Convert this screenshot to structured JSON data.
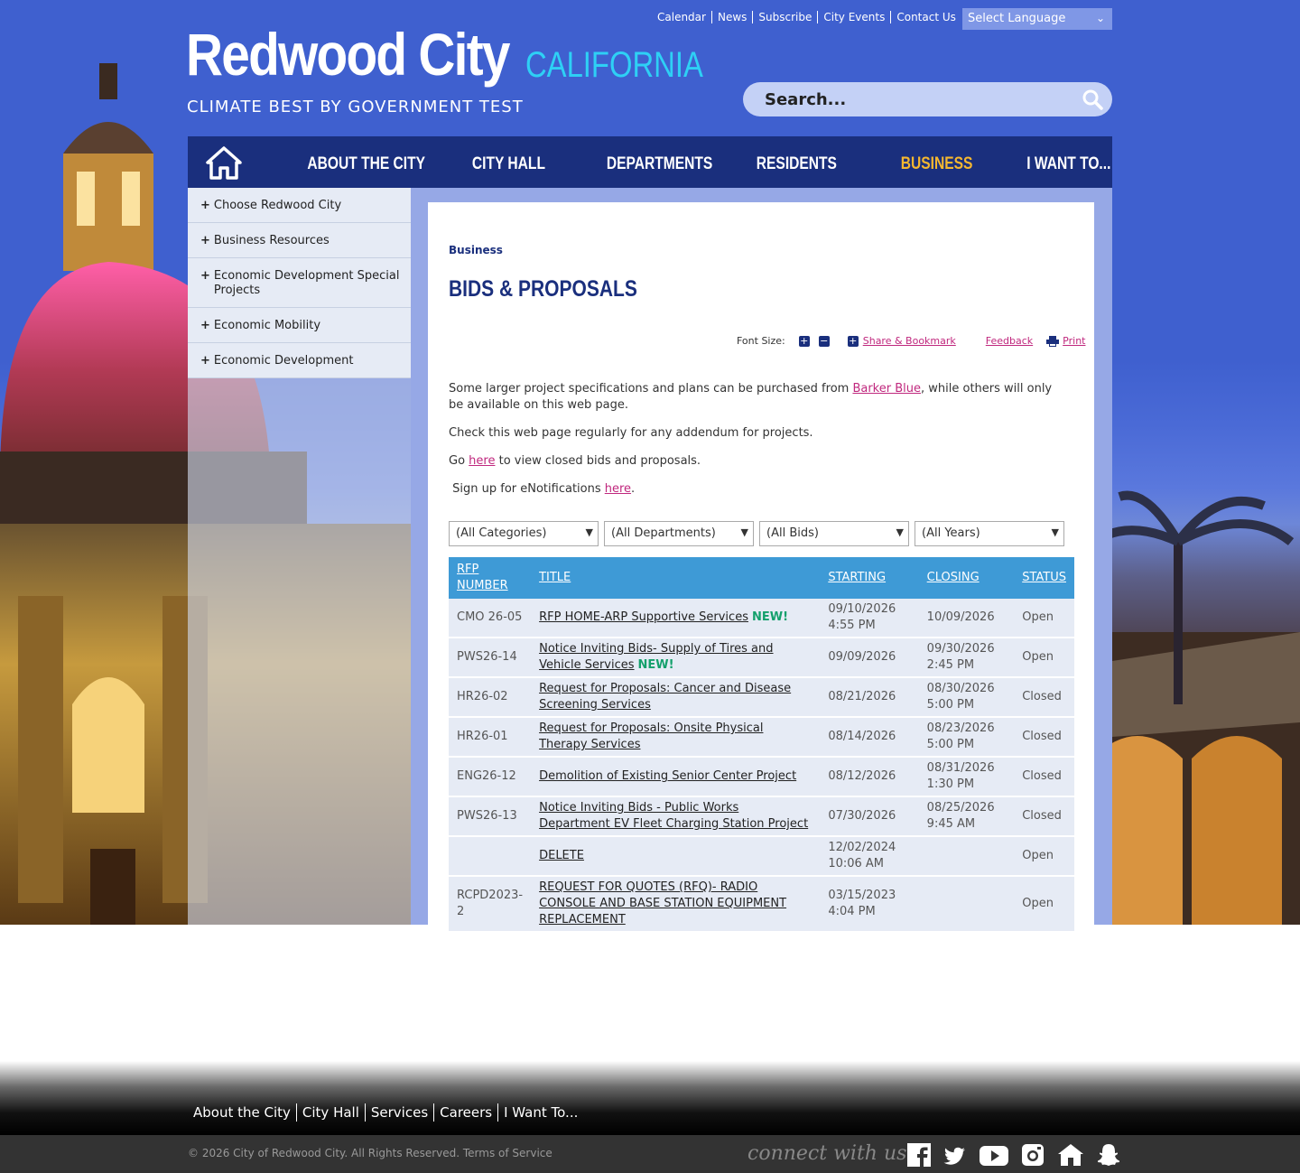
{
  "utility": {
    "links": [
      "Calendar",
      "News",
      "Subscribe",
      "City Events",
      "Contact Us"
    ],
    "language": "Select Language"
  },
  "brand": {
    "title": "Redwood City",
    "state": "CALIFORNIA",
    "tagline": "CLIMATE BEST BY GOVERNMENT TEST"
  },
  "search": {
    "placeholder": "Search..."
  },
  "nav": {
    "items": [
      "ABOUT THE CITY",
      "CITY HALL",
      "DEPARTMENTS",
      "RESIDENTS",
      "BUSINESS",
      "I WANT TO..."
    ],
    "active": "BUSINESS"
  },
  "sidebar": {
    "items": [
      "Choose Redwood City",
      "Business Resources",
      "Economic Development Special Projects",
      "Economic Mobility",
      "Economic Development"
    ]
  },
  "page": {
    "breadcrumb": "Business",
    "title": "BIDS & PROPOSALS",
    "tools": {
      "font_size": "Font Size:",
      "share": "Share & Bookmark",
      "feedback": "Feedback",
      "print": "Print"
    },
    "intro": {
      "p1_before": "Some larger project specifications and plans can be purchased from ",
      "p1_link": "Barker Blue",
      "p1_after": ", while others will only be available on this web page.",
      "p2": "Check this web page regularly for any addendum for projects.",
      "p3_before": "Go ",
      "p3_link": "here",
      "p3_after": " to view closed bids and proposals.",
      "p4_before": " Sign up for eNotifications ",
      "p4_link": "here",
      "p4_after": "."
    },
    "filters": [
      "(All Categories)",
      "(All Departments)",
      "(All Bids)",
      "(All Years)"
    ]
  },
  "table": {
    "headers": {
      "rfp": "RFP NUMBER",
      "title": "TITLE",
      "starting": "STARTING",
      "closing": "CLOSING",
      "status": "STATUS"
    },
    "new_label": "NEW!",
    "rows": [
      {
        "rfp": "CMO 26-05",
        "title": "RFP HOME-ARP Supportive Services",
        "new": true,
        "starting": "09/10/2026 4:55 PM",
        "closing": "10/09/2026",
        "status": "Open"
      },
      {
        "rfp": "PWS26-14",
        "title": "Notice Inviting Bids- Supply of Tires and Vehicle Services",
        "new": true,
        "starting": "09/09/2026",
        "closing": "09/30/2026 2:45 PM",
        "status": "Open"
      },
      {
        "rfp": "HR26-02",
        "title": "Request for Proposals: Cancer and Disease Screening Services",
        "new": false,
        "starting": "08/21/2026",
        "closing": "08/30/2026 5:00 PM",
        "status": "Closed"
      },
      {
        "rfp": "HR26-01",
        "title": "Request for Proposals: Onsite Physical Therapy Services",
        "new": false,
        "starting": "08/14/2026",
        "closing": "08/23/2026 5:00 PM",
        "status": "Closed"
      },
      {
        "rfp": "ENG26-12",
        "title": "Demolition of Existing Senior Center Project",
        "new": false,
        "starting": "08/12/2026",
        "closing": "08/31/2026 1:30 PM",
        "status": "Closed"
      },
      {
        "rfp": "PWS26-13",
        "title": "Notice Inviting Bids - Public Works Department EV Fleet Charging Station Project",
        "new": false,
        "starting": "07/30/2026",
        "closing": "08/25/2026 9:45 AM",
        "status": "Closed"
      },
      {
        "rfp": "",
        "title": "DELETE",
        "new": false,
        "starting": "12/02/2024 10:06 AM",
        "closing": "",
        "status": "Open"
      },
      {
        "rfp": "RCPD2023-2",
        "title": "REQUEST FOR QUOTES (RFQ)- RADIO CONSOLE AND BASE STATION EQUIPMENT REPLACEMENT",
        "new": false,
        "starting": "03/15/2023 4:04 PM",
        "closing": "",
        "status": "Open"
      }
    ]
  },
  "footer": {
    "links": [
      "About the City",
      "City Hall",
      "Services",
      "Careers",
      "I Want To..."
    ],
    "copyright": "© 2026 City of Redwood City. All Rights Reserved. Terms of Service",
    "connect": "connect with us",
    "social": [
      "facebook-icon",
      "twitter-icon",
      "youtube-icon",
      "instagram-icon",
      "nextdoor-icon",
      "snapchat-icon"
    ]
  },
  "colors": {
    "header_blue": "#3f60cf",
    "nav_navy": "#1a2f7d",
    "active_nav": "#f5b730",
    "brand_cyan": "#2ed0f5",
    "table_header": "#3e9ad6",
    "link_magenta": "#c0287e",
    "new_green": "#14a06c"
  }
}
